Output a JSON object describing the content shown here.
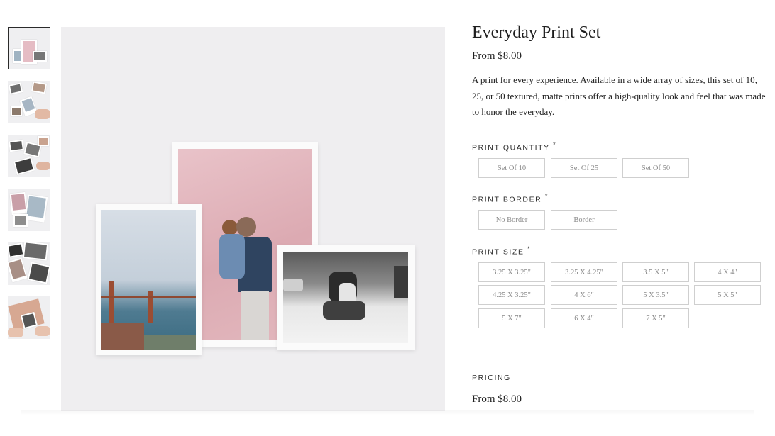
{
  "product": {
    "title": "Everyday Print Set",
    "price": "From $8.00",
    "description": "A print for every experience. Available in a wide array of sizes, this set of 10, 25, or 50 textured, matte prints offer a high-quality look and feel that was made to honor the everyday."
  },
  "thumbnails": [
    {
      "alt": "print set on stand"
    },
    {
      "alt": "hands holding prints"
    },
    {
      "alt": "prints on table"
    },
    {
      "alt": "prints fanned out"
    },
    {
      "alt": "black and white prints"
    },
    {
      "alt": "hands with print box"
    }
  ],
  "options": {
    "quantity": {
      "label": "PRINT QUANTITY",
      "required": "*",
      "choices": [
        "Set Of 10",
        "Set Of 25",
        "Set Of 50"
      ]
    },
    "border": {
      "label": "PRINT BORDER",
      "required": "*",
      "choices": [
        "No Border",
        "Border"
      ]
    },
    "size": {
      "label": "PRINT SIZE",
      "required": "*",
      "choices": [
        "3.25 X 3.25\"",
        "3.25 X 4.25\"",
        "3.5 X 5\"",
        "4 X 4\"",
        "4.25 X 3.25\"",
        "4 X 6\"",
        "5 X 3.5\"",
        "5 X 5\"",
        "5 X 7\"",
        "6 X 4\"",
        "7 X 5\""
      ]
    }
  },
  "pricing": {
    "label": "PRICING",
    "value": "From $8.00"
  }
}
